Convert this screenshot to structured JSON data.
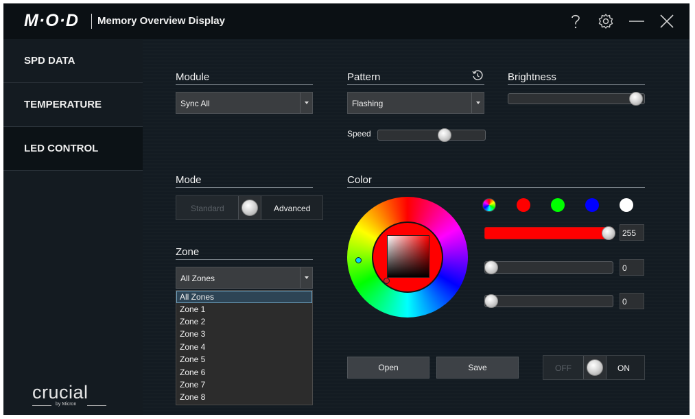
{
  "app": {
    "logo": "M·O·D",
    "title": "Memory Overview Display"
  },
  "titlebar_icons": [
    "help-icon",
    "gear-icon",
    "minimize-icon",
    "close-icon"
  ],
  "sidebar": {
    "items": [
      {
        "label": "SPD DATA",
        "active": false
      },
      {
        "label": "TEMPERATURE",
        "active": false
      },
      {
        "label": "LED CONTROL",
        "active": true
      }
    ],
    "brand": {
      "name": "crucial",
      "sub": "by Micron"
    }
  },
  "module": {
    "label": "Module",
    "value": "Sync All"
  },
  "pattern": {
    "label": "Pattern",
    "value": "Flashing",
    "speed_label": "Speed",
    "speed_level": 0.63
  },
  "brightness": {
    "label": "Brightness",
    "level": 0.98
  },
  "mode": {
    "label": "Mode",
    "off_label": "Standard",
    "on_label": "Advanced",
    "state": "Advanced"
  },
  "zone": {
    "label": "Zone",
    "value": "All Zones",
    "options": [
      "All Zones",
      "Zone 1",
      "Zone 2",
      "Zone 3",
      "Zone 4",
      "Zone 5",
      "Zone 6",
      "Zone 7",
      "Zone 8"
    ],
    "selected_index": 0
  },
  "color": {
    "label": "Color",
    "presets": [
      "#ff0000",
      "#00ff00",
      "#0000ff",
      "#ffffff"
    ],
    "current": "#ff0000",
    "r": "255",
    "g": "0",
    "b": "0"
  },
  "buttons": {
    "open": "Open",
    "save": "Save"
  },
  "power": {
    "off_label": "OFF",
    "on_label": "ON",
    "state": "ON"
  },
  "colors": {
    "accent_red": "#ff0000",
    "bg": "#131b22",
    "titlebar": "#0b1014"
  }
}
